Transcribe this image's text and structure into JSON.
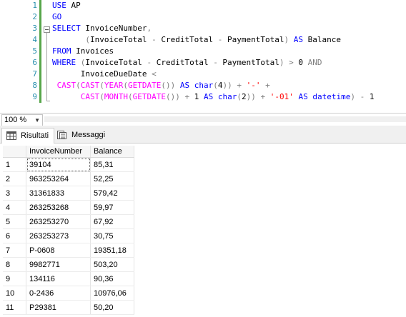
{
  "editor": {
    "line_numbers": [
      "1",
      "2",
      "3",
      "4",
      "5",
      "6",
      "7",
      "8",
      "9"
    ],
    "lines": [
      {
        "tokens": [
          {
            "t": "USE ",
            "c": "kw"
          },
          {
            "t": "AP",
            "c": ""
          }
        ]
      },
      {
        "tokens": [
          {
            "t": "GO",
            "c": "kw"
          }
        ]
      },
      {
        "tokens": [
          {
            "t": "SELECT ",
            "c": "kw"
          },
          {
            "t": "InvoiceNumber",
            "c": ""
          },
          {
            "t": ",",
            "c": "gy"
          }
        ]
      },
      {
        "tokens": [
          {
            "t": "       ",
            "c": ""
          },
          {
            "t": "(",
            "c": "gy"
          },
          {
            "t": "InvoiceTotal ",
            "c": ""
          },
          {
            "t": "-",
            "c": "gy"
          },
          {
            "t": " CreditTotal ",
            "c": ""
          },
          {
            "t": "-",
            "c": "gy"
          },
          {
            "t": " PaymentTotal",
            "c": ""
          },
          {
            "t": ")",
            "c": "gy"
          },
          {
            "t": " AS ",
            "c": "kw"
          },
          {
            "t": "Balance",
            "c": ""
          }
        ]
      },
      {
        "tokens": [
          {
            "t": "FROM ",
            "c": "kw"
          },
          {
            "t": "Invoices",
            "c": ""
          }
        ]
      },
      {
        "tokens": [
          {
            "t": "WHERE ",
            "c": "kw"
          },
          {
            "t": "(",
            "c": "gy"
          },
          {
            "t": "InvoiceTotal ",
            "c": ""
          },
          {
            "t": "-",
            "c": "gy"
          },
          {
            "t": " CreditTotal ",
            "c": ""
          },
          {
            "t": "-",
            "c": "gy"
          },
          {
            "t": " PaymentTotal",
            "c": ""
          },
          {
            "t": ")",
            "c": "gy"
          },
          {
            "t": " > ",
            "c": "gy"
          },
          {
            "t": "0 ",
            "c": ""
          },
          {
            "t": "AND",
            "c": "gy"
          }
        ]
      },
      {
        "tokens": [
          {
            "t": "      InvoiceDueDate ",
            "c": ""
          },
          {
            "t": "<",
            "c": "gy"
          }
        ]
      },
      {
        "tokens": [
          {
            "t": " CAST",
            "c": "fn"
          },
          {
            "t": "(",
            "c": "gy"
          },
          {
            "t": "CAST",
            "c": "fn"
          },
          {
            "t": "(",
            "c": "gy"
          },
          {
            "t": "YEAR",
            "c": "fn"
          },
          {
            "t": "(",
            "c": "gy"
          },
          {
            "t": "GETDATE",
            "c": "fn"
          },
          {
            "t": "())",
            "c": "gy"
          },
          {
            "t": " AS ",
            "c": "kw"
          },
          {
            "t": "char",
            "c": "kw"
          },
          {
            "t": "(",
            "c": "gy"
          },
          {
            "t": "4",
            "c": ""
          },
          {
            "t": "))",
            "c": "gy"
          },
          {
            "t": " + ",
            "c": "gy"
          },
          {
            "t": "'-'",
            "c": "st"
          },
          {
            "t": " +",
            "c": "gy"
          }
        ]
      },
      {
        "tokens": [
          {
            "t": "      CAST",
            "c": "fn"
          },
          {
            "t": "(",
            "c": "gy"
          },
          {
            "t": "MONTH",
            "c": "fn"
          },
          {
            "t": "(",
            "c": "gy"
          },
          {
            "t": "GETDATE",
            "c": "fn"
          },
          {
            "t": "())",
            "c": "gy"
          },
          {
            "t": " + ",
            "c": "gy"
          },
          {
            "t": "1 ",
            "c": ""
          },
          {
            "t": "AS ",
            "c": "kw"
          },
          {
            "t": "char",
            "c": "kw"
          },
          {
            "t": "(",
            "c": "gy"
          },
          {
            "t": "2",
            "c": ""
          },
          {
            "t": "))",
            "c": "gy"
          },
          {
            "t": " + ",
            "c": "gy"
          },
          {
            "t": "'-01'",
            "c": "st"
          },
          {
            "t": " AS ",
            "c": "kw"
          },
          {
            "t": "datetime",
            "c": "kw"
          },
          {
            "t": ")",
            "c": "gy"
          },
          {
            "t": " - ",
            "c": "gy"
          },
          {
            "t": "1",
            "c": ""
          }
        ]
      }
    ]
  },
  "zoom": {
    "value": "100 %"
  },
  "tabs": [
    {
      "label": "Risultati",
      "icon": "grid-icon",
      "active": true
    },
    {
      "label": "Messaggi",
      "icon": "messages-icon",
      "active": false
    }
  ],
  "grid": {
    "columns": [
      "InvoiceNumber",
      "Balance"
    ],
    "rows": [
      [
        "1",
        "39104",
        "85,31"
      ],
      [
        "2",
        "963253264",
        "52,25"
      ],
      [
        "3",
        "31361833",
        "579,42"
      ],
      [
        "4",
        "263253268",
        "59,97"
      ],
      [
        "5",
        "263253270",
        "67,92"
      ],
      [
        "6",
        "263253273",
        "30,75"
      ],
      [
        "7",
        "P-0608",
        "19351,18"
      ],
      [
        "8",
        "9982771",
        "503,20"
      ],
      [
        "9",
        "134116",
        "90,36"
      ],
      [
        "10",
        "0-2436",
        "10976,06"
      ],
      [
        "11",
        "P29381",
        "50,20"
      ]
    ]
  },
  "colors": {
    "keyword": "#0000ff",
    "function": "#ff00ff",
    "operator": "#808080",
    "string": "#ff0000",
    "line_number": "#2b91af",
    "changed_marker": "#57a64a"
  }
}
